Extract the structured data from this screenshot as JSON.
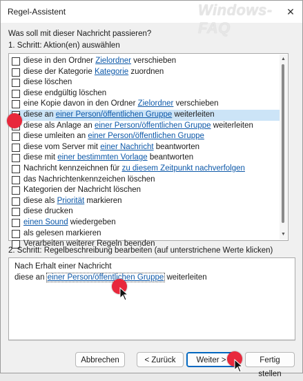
{
  "window": {
    "title": "Regel-Assistent",
    "watermark": "Windows-FAQ",
    "close_glyph": "✕"
  },
  "question": "Was soll mit dieser Nachricht passieren?",
  "step1_label": "1. Schritt: Aktion(en) auswählen",
  "actions": [
    {
      "pre": "diese in den Ordner ",
      "link": "Zielordner",
      "post": " verschieben",
      "checked": false
    },
    {
      "pre": "diese der Kategorie ",
      "link": "Kategorie",
      "post": " zuordnen",
      "checked": false
    },
    {
      "pre": "diese löschen",
      "link": "",
      "post": "",
      "checked": false
    },
    {
      "pre": "diese endgültig löschen",
      "link": "",
      "post": "",
      "checked": false
    },
    {
      "pre": "eine Kopie davon in den Ordner ",
      "link": "Zielordner",
      "post": " verschieben",
      "checked": false
    },
    {
      "pre": "diese an ",
      "link": "einer Person/öffentlichen Gruppe",
      "post": " weiterleiten",
      "checked": true
    },
    {
      "pre": "diese als Anlage an ",
      "link": "einer Person/öffentlichen Gruppe",
      "post": " weiterleiten",
      "checked": false
    },
    {
      "pre": "diese umleiten an ",
      "link": "einer Person/öffentlichen Gruppe",
      "post": "",
      "checked": false
    },
    {
      "pre": "diese vom Server mit ",
      "link": "einer Nachricht",
      "post": " beantworten",
      "checked": false
    },
    {
      "pre": "diese mit ",
      "link": "einer bestimmten Vorlage",
      "post": " beantworten",
      "checked": false
    },
    {
      "pre": "Nachricht kennzeichnen für ",
      "link": "zu diesem Zeitpunkt nachverfolgen",
      "post": "",
      "checked": false
    },
    {
      "pre": "das Nachrichtenkennzeichen löschen",
      "link": "",
      "post": "",
      "checked": false
    },
    {
      "pre": "Kategorien der Nachricht löschen",
      "link": "",
      "post": "",
      "checked": false
    },
    {
      "pre": "diese als ",
      "link": "Priorität",
      "post": " markieren",
      "checked": false
    },
    {
      "pre": "diese drucken",
      "link": "",
      "post": "",
      "checked": false
    },
    {
      "pre": "",
      "link": "einen Sound",
      "post": " wiedergeben",
      "checked": false
    },
    {
      "pre": "als gelesen markieren",
      "link": "",
      "post": "",
      "checked": false
    },
    {
      "pre": "Verarbeiten weiterer Regeln beenden",
      "link": "",
      "post": "",
      "checked": false
    }
  ],
  "step2_label": "2. Schritt: Regelbeschreibung bearbeiten (auf unterstrichene Werte klicken)",
  "description": {
    "line1": "Nach Erhalt einer Nachricht",
    "line2_pre": "diese an ",
    "line2_link": "einer Person/öffentlichen Gruppe",
    "line2_post": " weiterleiten"
  },
  "buttons": {
    "cancel": "Abbrechen",
    "back": "< Zurück",
    "next": "Weiter >",
    "finish": "Fertig stellen"
  },
  "scrollbar": {
    "up": "▲",
    "down": "▼"
  },
  "colors": {
    "link": "#0b57a8",
    "selection": "#cce4f7",
    "marker": "#e8283c",
    "primary_border": "#0067c0"
  }
}
